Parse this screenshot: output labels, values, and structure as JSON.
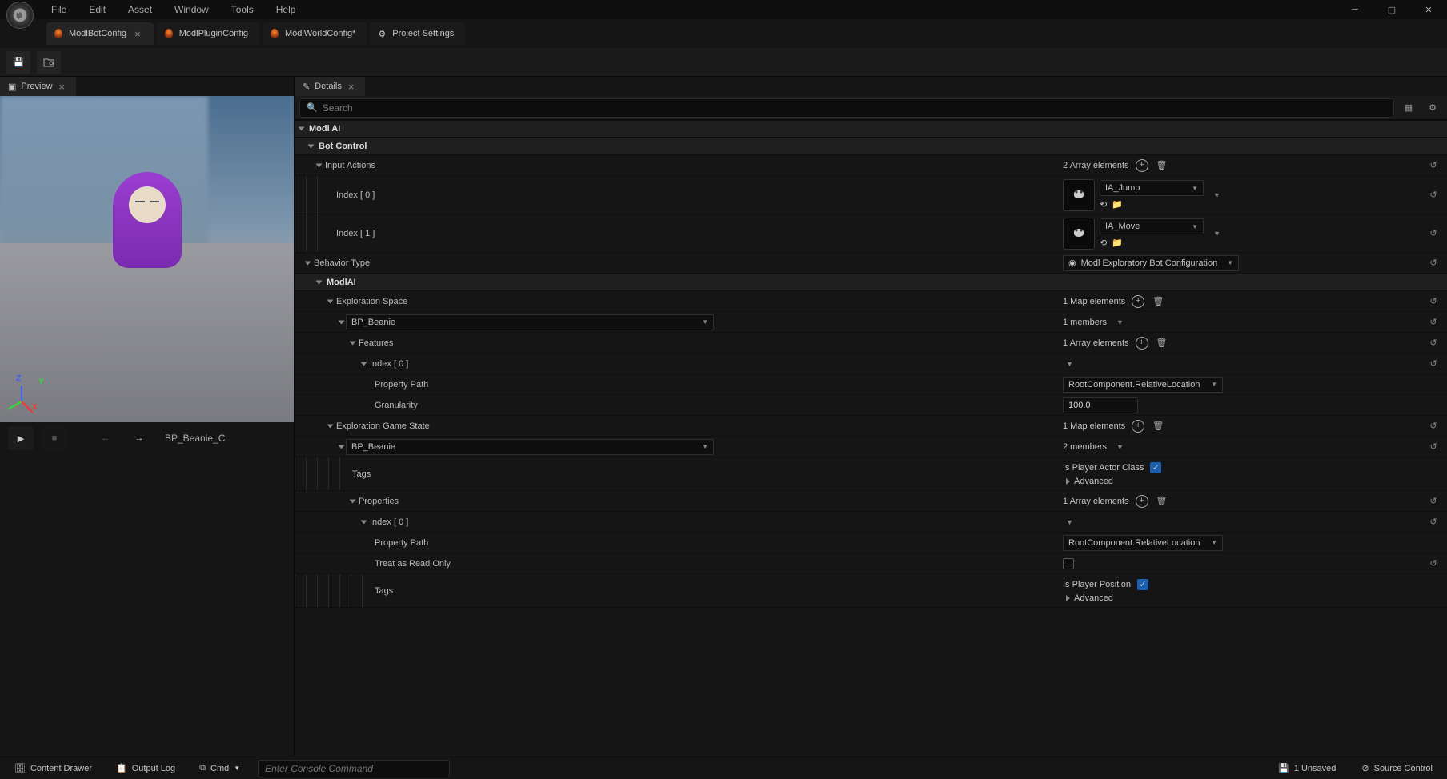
{
  "menu": [
    "File",
    "Edit",
    "Asset",
    "Window",
    "Tools",
    "Help"
  ],
  "tabs": [
    {
      "label": "ModlBotConfig",
      "active": true,
      "closable": true,
      "flame": true
    },
    {
      "label": "ModlPluginConfig",
      "flame": true
    },
    {
      "label": "ModlWorldConfig*",
      "flame": true
    },
    {
      "label": "Project Settings",
      "gear": true
    }
  ],
  "preview_tab": "Preview",
  "details_tab": "Details",
  "search_placeholder": "Search",
  "asset_name": "BP_Beanie_C",
  "cat_modlai": "Modl AI",
  "cat_botcontrol": "Bot Control",
  "r_input_actions": {
    "label": "Input Actions",
    "count": "2 Array elements"
  },
  "ia0": {
    "idx": "Index [ 0 ]",
    "val": "IA_Jump"
  },
  "ia1": {
    "idx": "Index [ 1 ]",
    "val": "IA_Move"
  },
  "r_behavior": {
    "label": "Behavior Type",
    "val": "Modl Exploratory Bot Configuration"
  },
  "cat_modlai2": "ModlAI",
  "r_expspace": {
    "label": "Exploration Space",
    "count": "1 Map elements"
  },
  "bp_beanie": "BP_Beanie",
  "members1": "1 members",
  "r_features": {
    "label": "Features",
    "count": "1 Array elements"
  },
  "idx0": "Index [ 0 ]",
  "proppath": "Property Path",
  "proppath_val": "RootComponent.RelativeLocation",
  "granularity": "Granularity",
  "gran_val": "100.0",
  "r_expstate": {
    "label": "Exploration Game State",
    "count": "1 Map elements"
  },
  "members2": "2 members",
  "tags": "Tags",
  "is_player_actor": "Is Player Actor Class",
  "advanced": "Advanced",
  "r_props": {
    "label": "Properties",
    "count": "1 Array elements"
  },
  "treat_ro": "Treat as Read Only",
  "is_player_pos": "Is Player Position",
  "status": {
    "drawer": "Content Drawer",
    "outlog": "Output Log",
    "cmd": "Cmd",
    "cmd_ph": "Enter Console Command",
    "unsaved": "1 Unsaved",
    "source": "Source Control"
  }
}
